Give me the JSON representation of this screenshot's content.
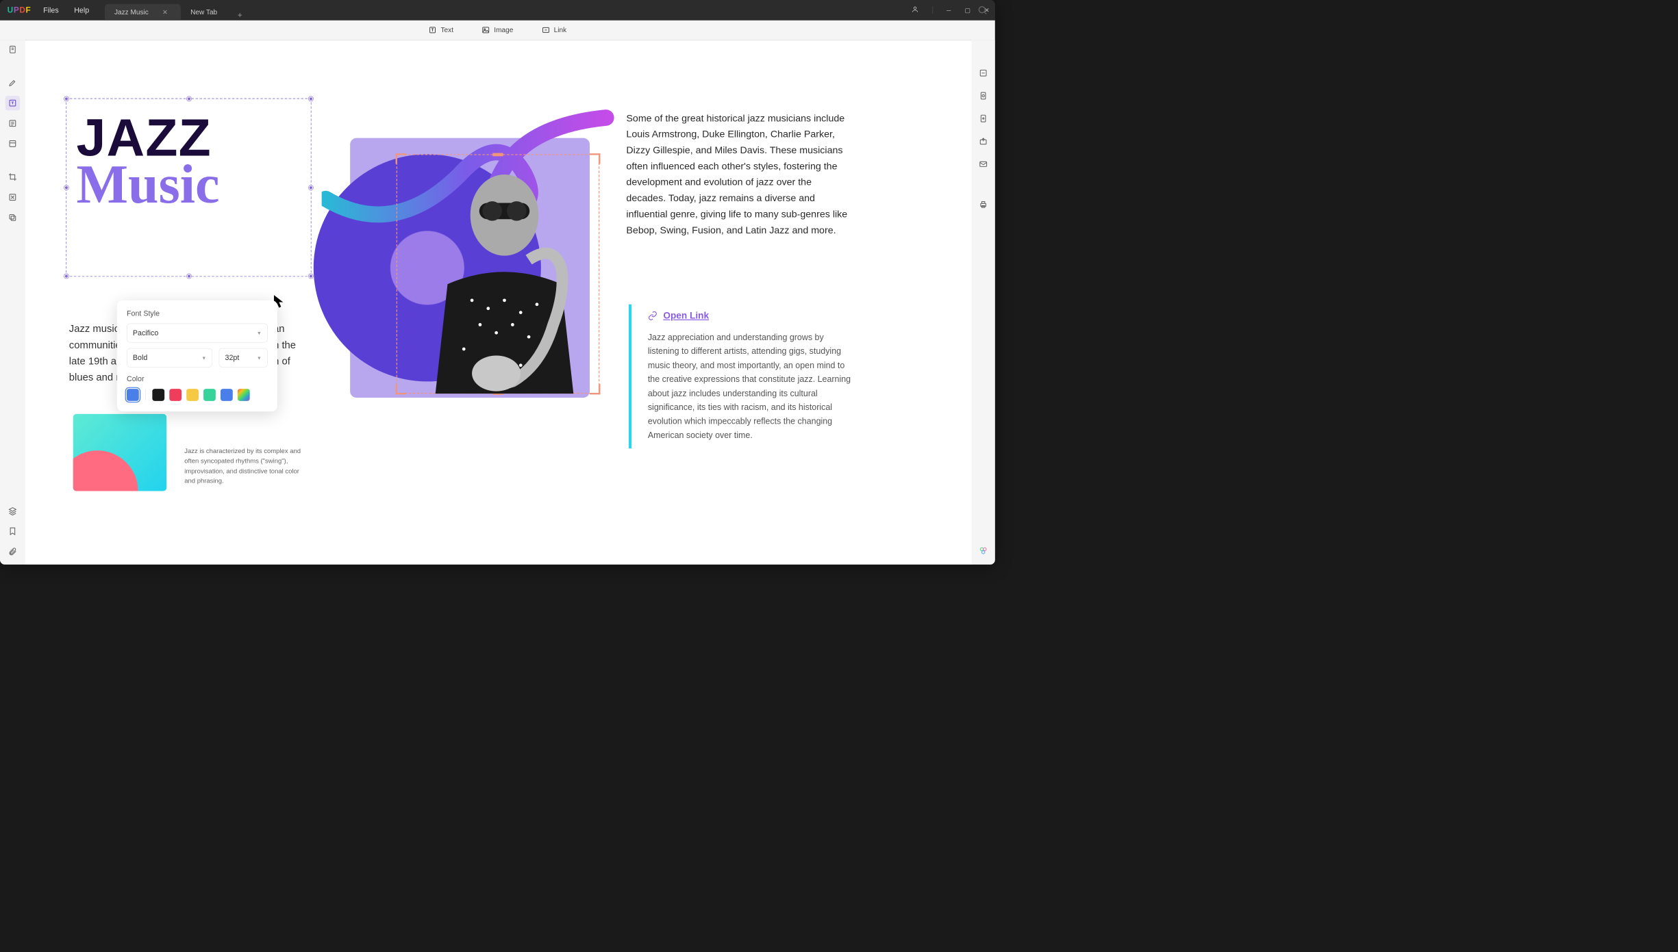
{
  "app": {
    "logo_chars": [
      "U",
      "P",
      "D",
      "F"
    ]
  },
  "menu": {
    "files": "Files",
    "help": "Help"
  },
  "tabs": [
    {
      "label": "Jazz Music",
      "active": true
    },
    {
      "label": "New Tab",
      "active": false
    }
  ],
  "toolbar": {
    "text": "Text",
    "image": "Image",
    "link": "Link"
  },
  "document": {
    "title_line1": "JAZZ",
    "title_line2": "Music",
    "intro": "Jazz music has its roots in the African-American communities of New Orleans, United States, in the late 19th and early 20th centuries. It is a fusion of blues and ragtime.",
    "caption": "Jazz is characterized by its complex and often syncopated rhythms (\"swing\"), improvisation, and distinctive tonal color and phrasing.",
    "right_paragraph": "Some of the great historical jazz musicians include Louis Armstrong, Duke Ellington, Charlie Parker, Dizzy Gillespie, and Miles Davis. These musicians often influenced each other's styles, fostering the development and evolution of jazz over the decades. Today, jazz remains a diverse and influential genre, giving life to many sub-genres like Bebop, Swing, Fusion, and Latin Jazz and more.",
    "link": {
      "label": "Open Link",
      "body": "Jazz appreciation and understanding grows by listening to different artists, attending gigs, studying music theory, and most importantly, an open mind to the creative expressions that constitute jazz. Learning about jazz includes understanding its cultural significance, its ties with racism, and its historical evolution which impeccably reflects the changing American society over time."
    }
  },
  "font_panel": {
    "title": "Font Style",
    "font_family": "Pacifico",
    "font_weight": "Bold",
    "font_size": "32pt",
    "color_label": "Color",
    "swatches": [
      "#4a7ee8",
      "#1a1a1a",
      "#ef3e5b",
      "#f6c945",
      "#36d39a",
      "#4a7ee8",
      "gradient"
    ],
    "selected_index": 0
  },
  "sidebar_icons": [
    "page-icon",
    "highlighter-icon",
    "edit-text-icon",
    "form-icon",
    "page-layout-icon",
    "crop-icon",
    "ocr-icon",
    "convert-icon"
  ],
  "sidebar_bottom": [
    "layers-icon",
    "bookmark-icon",
    "attachment-icon"
  ],
  "right_rail_icons": [
    "export-icon",
    "document-icon",
    "save-icon",
    "share-icon",
    "mail-icon",
    "print-icon"
  ]
}
